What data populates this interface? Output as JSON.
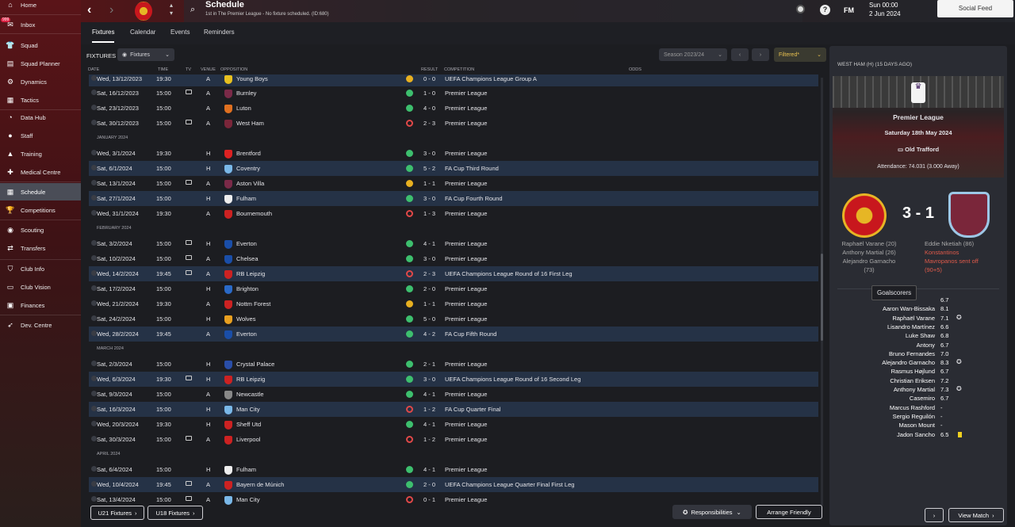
{
  "sidebar": {
    "items": [
      {
        "label": "Home",
        "icon": "home-icon",
        "glyph": "⌂"
      },
      {
        "label": "Inbox",
        "icon": "inbox-icon",
        "glyph": "✉",
        "badge": "999"
      },
      {
        "label": "Squad",
        "icon": "squad-icon",
        "glyph": "👕"
      },
      {
        "label": "Squad Planner",
        "icon": "squad-planner-icon",
        "glyph": "▤"
      },
      {
        "label": "Dynamics",
        "icon": "dynamics-icon",
        "glyph": "⚙"
      },
      {
        "label": "Tactics",
        "icon": "tactics-icon",
        "glyph": "▦"
      },
      {
        "label": "Data Hub",
        "icon": "data-hub-icon",
        "glyph": "◔"
      },
      {
        "label": "Staff",
        "icon": "staff-icon",
        "glyph": "●"
      },
      {
        "label": "Training",
        "icon": "training-icon",
        "glyph": "▲"
      },
      {
        "label": "Medical Centre",
        "icon": "medical-centre-icon",
        "glyph": "✚"
      },
      {
        "label": "Schedule",
        "icon": "calendar-icon",
        "glyph": "▦",
        "active": true
      },
      {
        "label": "Competitions",
        "icon": "trophy-icon",
        "glyph": "🏆"
      },
      {
        "label": "Scouting",
        "icon": "scouting-icon",
        "glyph": "◉"
      },
      {
        "label": "Transfers",
        "icon": "transfers-icon",
        "glyph": "⇄"
      },
      {
        "label": "Club Info",
        "icon": "club-info-icon",
        "glyph": "⛉"
      },
      {
        "label": "Club Vision",
        "icon": "club-vision-icon",
        "glyph": "▭"
      },
      {
        "label": "Finances",
        "icon": "finances-icon",
        "glyph": "▣"
      },
      {
        "label": "Dev. Centre",
        "icon": "dev-centre-icon",
        "glyph": "➶"
      }
    ]
  },
  "header": {
    "title": "Schedule",
    "subtitle": "1st in The Premier League - No fixture scheduled. (ID:680)",
    "date_line1": "Sun 00:00",
    "date_line2": "2 Jun 2024",
    "social_feed": "Social Feed",
    "fm": "FM",
    "help": "?"
  },
  "tabs": [
    "Fixtures",
    "Calendar",
    "Events",
    "Reminders"
  ],
  "toolbar": {
    "fixtures_label": "FIXTURES",
    "view_select": "Fixtures",
    "season": "Season 2023/24",
    "filter": "Filtered*"
  },
  "columns": {
    "date": "DATE",
    "time": "TIME",
    "tv": "TV",
    "venue": "VENUE",
    "opposition": "OPPOSITION",
    "result": "RESULT",
    "competition": "COMPETITION",
    "odds": "ODDS"
  },
  "fixtures": [
    {
      "date": "Wed, 13/12/2023",
      "time": "19:30",
      "tv": false,
      "venue": "A",
      "opp": "Young Boys",
      "crest": "#e8c020",
      "res": "D",
      "score": "0 - 0",
      "comp": "UEFA Champions League Group A",
      "alt": true
    },
    {
      "date": "Sat, 16/12/2023",
      "time": "15:00",
      "tv": true,
      "venue": "A",
      "opp": "Burnley",
      "crest": "#7a2a48",
      "res": "W",
      "score": "1 - 0",
      "comp": "Premier League"
    },
    {
      "date": "Sat, 23/12/2023",
      "time": "15:00",
      "tv": false,
      "venue": "A",
      "opp": "Luton",
      "crest": "#e07020",
      "res": "W",
      "score": "4 - 0",
      "comp": "Premier League"
    },
    {
      "date": "Sat, 30/12/2023",
      "time": "15:00",
      "tv": true,
      "venue": "A",
      "opp": "West Ham",
      "crest": "#7a263a",
      "res": "L",
      "score": "2 - 3",
      "comp": "Premier League"
    },
    {
      "month": "JANUARY 2024"
    },
    {
      "date": "Wed, 3/1/2024",
      "time": "19:30",
      "tv": false,
      "venue": "H",
      "opp": "Brentford",
      "crest": "#d22",
      "res": "W",
      "score": "3 - 0",
      "comp": "Premier League"
    },
    {
      "date": "Sat, 6/1/2024",
      "time": "15:00",
      "tv": false,
      "venue": "H",
      "opp": "Coventry",
      "crest": "#7ab8e8",
      "res": "W",
      "score": "5 - 2",
      "comp": "FA Cup Third Round",
      "alt": true
    },
    {
      "date": "Sat, 13/1/2024",
      "time": "15:00",
      "tv": true,
      "venue": "A",
      "opp": "Aston Villa",
      "crest": "#7a2a48",
      "res": "D",
      "score": "1 - 1",
      "comp": "Premier League"
    },
    {
      "date": "Sat, 27/1/2024",
      "time": "15:00",
      "tv": false,
      "venue": "H",
      "opp": "Fulham",
      "crest": "#eeeeee",
      "res": "W",
      "score": "3 - 0",
      "comp": "FA Cup Fourth Round",
      "alt": true
    },
    {
      "date": "Wed, 31/1/2024",
      "time": "19:30",
      "tv": false,
      "venue": "A",
      "opp": "Bournemouth",
      "crest": "#c22",
      "res": "L",
      "score": "1 - 3",
      "comp": "Premier League"
    },
    {
      "month": "FEBRUARY 2024"
    },
    {
      "date": "Sat, 3/2/2024",
      "time": "15:00",
      "tv": true,
      "venue": "H",
      "opp": "Everton",
      "crest": "#1a4ea8",
      "res": "W",
      "score": "4 - 1",
      "comp": "Premier League"
    },
    {
      "date": "Sat, 10/2/2024",
      "time": "15:00",
      "tv": true,
      "venue": "A",
      "opp": "Chelsea",
      "crest": "#1a4ea8",
      "res": "W",
      "score": "3 - 0",
      "comp": "Premier League"
    },
    {
      "date": "Wed, 14/2/2024",
      "time": "19:45",
      "tv": true,
      "venue": "A",
      "opp": "RB Leipzig",
      "crest": "#c22",
      "res": "L",
      "score": "2 - 3",
      "comp": "UEFA Champions League Round of 16  First Leg",
      "alt": true
    },
    {
      "date": "Sat, 17/2/2024",
      "time": "15:00",
      "tv": false,
      "venue": "H",
      "opp": "Brighton",
      "crest": "#2a6ac8",
      "res": "W",
      "score": "2 - 0",
      "comp": "Premier League"
    },
    {
      "date": "Wed, 21/2/2024",
      "time": "19:30",
      "tv": false,
      "venue": "A",
      "opp": "Nottm Forest",
      "crest": "#c22",
      "res": "D",
      "score": "1 - 1",
      "comp": "Premier League"
    },
    {
      "date": "Sat, 24/2/2024",
      "time": "15:00",
      "tv": false,
      "venue": "H",
      "opp": "Wolves",
      "crest": "#e8a020",
      "res": "W",
      "score": "5 - 0",
      "comp": "Premier League"
    },
    {
      "date": "Wed, 28/2/2024",
      "time": "19:45",
      "tv": false,
      "venue": "A",
      "opp": "Everton",
      "crest": "#1a4ea8",
      "res": "W",
      "score": "4 - 2",
      "comp": "FA Cup Fifth Round",
      "alt": true
    },
    {
      "month": "MARCH 2024"
    },
    {
      "date": "Sat, 2/3/2024",
      "time": "15:00",
      "tv": false,
      "venue": "H",
      "opp": "Crystal Palace",
      "crest": "#2a4ea8",
      "res": "W",
      "score": "2 - 1",
      "comp": "Premier League"
    },
    {
      "date": "Wed, 6/3/2024",
      "time": "19:30",
      "tv": true,
      "venue": "H",
      "opp": "RB Leipzig",
      "crest": "#c22",
      "res": "W",
      "score": "3 - 0",
      "comp": "UEFA Champions League Round of 16  Second Leg",
      "alt": true
    },
    {
      "date": "Sat, 9/3/2024",
      "time": "15:00",
      "tv": false,
      "venue": "A",
      "opp": "Newcastle",
      "crest": "#888888",
      "res": "W",
      "score": "4 - 1",
      "comp": "Premier League"
    },
    {
      "date": "Sat, 16/3/2024",
      "time": "15:00",
      "tv": false,
      "venue": "H",
      "opp": "Man City",
      "crest": "#7ab8e8",
      "res": "L",
      "score": "1 - 2",
      "comp": "FA Cup Quarter Final",
      "alt": true
    },
    {
      "date": "Wed, 20/3/2024",
      "time": "19:30",
      "tv": false,
      "venue": "H",
      "opp": "Sheff Utd",
      "crest": "#c22",
      "res": "W",
      "score": "4 - 1",
      "comp": "Premier League"
    },
    {
      "date": "Sat, 30/3/2024",
      "time": "15:00",
      "tv": true,
      "venue": "A",
      "opp": "Liverpool",
      "crest": "#c22",
      "res": "L",
      "score": "1 - 2",
      "comp": "Premier League"
    },
    {
      "month": "APRIL 2024"
    },
    {
      "date": "Sat, 6/4/2024",
      "time": "15:00",
      "tv": false,
      "venue": "H",
      "opp": "Fulham",
      "crest": "#eeeeee",
      "res": "W",
      "score": "4 - 1",
      "comp": "Premier League"
    },
    {
      "date": "Wed, 10/4/2024",
      "time": "19:45",
      "tv": true,
      "venue": "A",
      "opp": "Bayern de Múnich",
      "crest": "#c22",
      "res": "W",
      "score": "2 - 0",
      "comp": "UEFA Champions League Quarter Final First Leg",
      "alt": true
    },
    {
      "date": "Sat, 13/4/2024",
      "time": "15:00",
      "tv": true,
      "venue": "A",
      "opp": "Man City",
      "crest": "#7ab8e8",
      "res": "L",
      "score": "0 - 1",
      "comp": "Premier League"
    }
  ],
  "bottom": {
    "u21": "U21 Fixtures",
    "u18": "U18 Fixtures",
    "responsibilities": "Responsibilities",
    "arrange": "Arrange Friendly"
  },
  "panel": {
    "header": "WEST HAM (H) (15 DAYS AGO)",
    "competition": "Premier League",
    "match_date": "Saturday 18th May 2024",
    "stadium": "Old Trafford",
    "attendance": "Attendance: 74.031 (3.000 Away)",
    "score": "3 - 1",
    "home_scorers": [
      "Raphaël Varane (20)",
      "Anthony Martial (26)",
      "Alejandro Garnacho",
      "(73)"
    ],
    "away_scorers": [
      "Eddie Nketiah (86)",
      "Konstantinos",
      "Mavropanos sent off",
      "(90+5)"
    ],
    "tooltip": "Goalscorers",
    "ratings": [
      {
        "name": "",
        "rating": "6.7",
        "award": false,
        "card": false
      },
      {
        "name": "Aaron Wan-Bissaka",
        "rating": "8.1",
        "award": false,
        "card": false
      },
      {
        "name": "Raphaël Varane",
        "rating": "7.1",
        "award": true,
        "card": false
      },
      {
        "name": "Lisandro Martínez",
        "rating": "6.6",
        "award": false,
        "card": false
      },
      {
        "name": "Luke Shaw",
        "rating": "6.8",
        "award": false,
        "card": false
      },
      {
        "name": "Antony",
        "rating": "6.7",
        "award": false,
        "card": false
      },
      {
        "name": "Bruno Fernandes",
        "rating": "7.0",
        "award": false,
        "card": false
      },
      {
        "name": "Alejandro Garnacho",
        "rating": "8.3",
        "award": true,
        "card": false
      },
      {
        "name": "Rasmus Højlund",
        "rating": "6.7",
        "award": false,
        "card": false
      },
      {
        "name": "Christian Eriksen",
        "rating": "7.2",
        "award": false,
        "card": false
      },
      {
        "name": "Anthony Martial",
        "rating": "7.3",
        "award": true,
        "card": false
      },
      {
        "name": "Casemiro",
        "rating": "6.7",
        "award": false,
        "card": false
      },
      {
        "name": "Marcus Rashford",
        "rating": "-",
        "award": false,
        "card": false
      },
      {
        "name": "Sergio Reguilón",
        "rating": "-",
        "award": false,
        "card": false
      },
      {
        "name": "Mason Mount",
        "rating": "-",
        "award": false,
        "card": false
      },
      {
        "name": "Jadon Sancho",
        "rating": "6.5",
        "award": false,
        "card": true
      }
    ],
    "view_match": "View Match"
  },
  "colors": {
    "win": "#3dbf6e",
    "draw": "#e8b020",
    "loss": "#e04848",
    "alt_row": "#253246",
    "red_card_text": "#e05a4a"
  }
}
